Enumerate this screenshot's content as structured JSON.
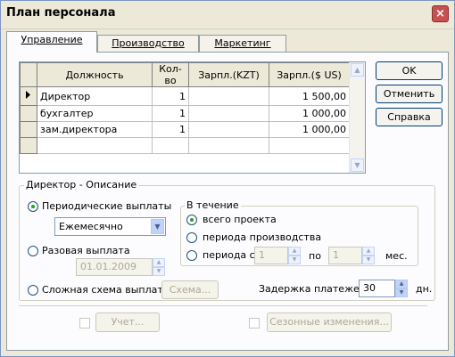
{
  "window": {
    "title": "План персонала",
    "close_label": "×"
  },
  "tabs": [
    {
      "label": "Управление",
      "active": true
    },
    {
      "label": "Производство",
      "active": false
    },
    {
      "label": "Маркетинг",
      "active": false
    }
  ],
  "grid": {
    "columns": [
      "Должность",
      "Кол-во",
      "Зарпл.(KZT)",
      "Зарпл.($ US)"
    ],
    "rows": [
      {
        "position": "Директор",
        "qty": "1",
        "salary_kzt": "",
        "salary_usd": "1 500,00",
        "current": true
      },
      {
        "position": "бухгалтер",
        "qty": "1",
        "salary_kzt": "",
        "salary_usd": "1 000,00",
        "current": false
      },
      {
        "position": "зам.директора",
        "qty": "1",
        "salary_kzt": "",
        "salary_usd": "1 000,00",
        "current": false
      }
    ]
  },
  "buttons": {
    "ok": "OK",
    "cancel": "Отменить",
    "help": "Справка"
  },
  "description": {
    "group_title": "Директор - Описание",
    "periodic_label": "Периодические выплаты",
    "periodic_selected": true,
    "frequency_value": "Ежемесячно",
    "one_time_label": "Разовая выплата",
    "one_time_date": "01.01.2009",
    "complex_label": "Сложная схема выплат",
    "scheme_button": "Схема...",
    "during": {
      "title": "В течение",
      "whole_project": "всего проекта",
      "production_period": "периода производства",
      "period_from": "периода с",
      "from_value": "1",
      "to_label": "по",
      "to_value": "1",
      "months_label": "мес.",
      "selected": "whole_project"
    },
    "delay_label": "Задержка платежей:",
    "delay_value": "30",
    "delay_unit": "дн."
  },
  "bottom": {
    "accounting_button": "Учет...",
    "seasonal_button": "Сезонные изменения..."
  }
}
